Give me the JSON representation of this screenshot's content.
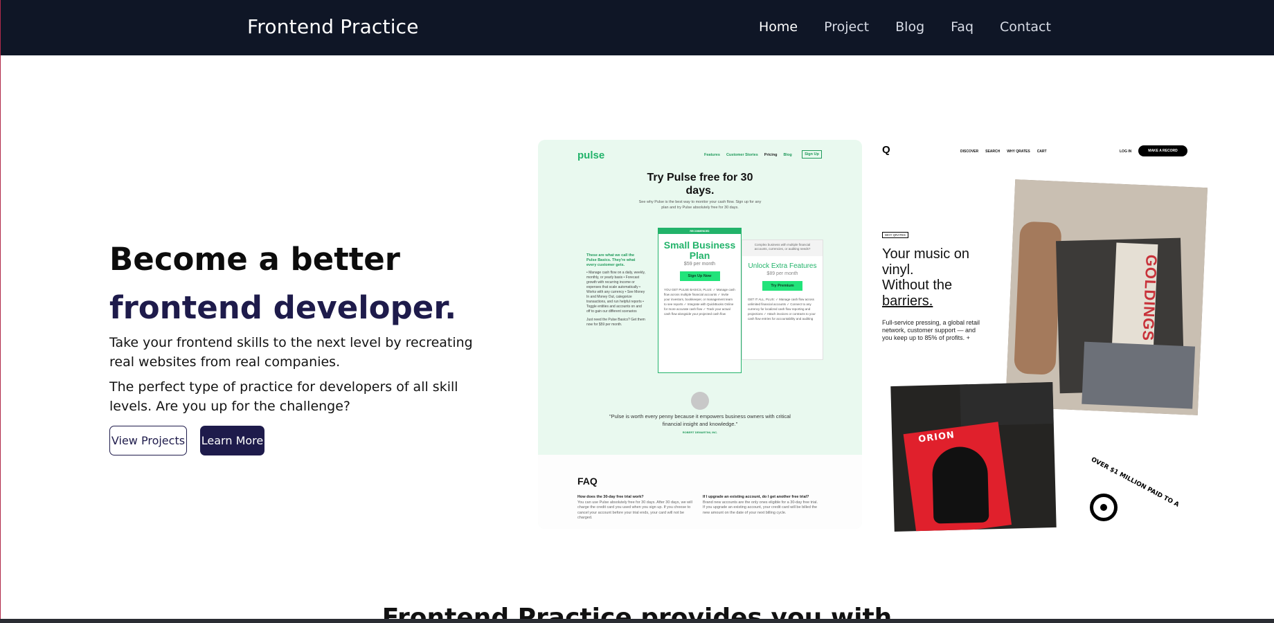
{
  "nav": {
    "brand": "Frontend Practice",
    "links": [
      "Home",
      "Project",
      "Blog",
      "Faq",
      "Contact"
    ]
  },
  "hero": {
    "title_line1": "Become a better",
    "title_line2": "frontend developer.",
    "para1": "Take your frontend skills to the next level by recreating real websites from real companies.",
    "para2": "The perfect type of practice for developers of all skill levels. Are you up for the challenge?",
    "btn_view": "View Projects",
    "btn_learn": "Learn More"
  },
  "pulse": {
    "logo": "pulse",
    "nav": [
      "Features",
      "Customer Stories",
      "Pricing",
      "Blog"
    ],
    "signup": "Sign Up",
    "heading": "Try Pulse free for 30 days.",
    "sub": "See why Pulse is the best way to monitor your cash flow. Sign up for any plan and try Pulse absolutely free for 30 days.",
    "left_title": "These are what we call the Pulse Basics. They're what every customer gets.",
    "left_list": "• Manage cash flow on a daily, weekly, monthly, or yearly basis • Forecast growth with recurring income or expenses that scale automatically • Works with any currency • See Money In and Money Out, categorize transactions, and run helpful reports • Toggle entities and accounts on and off to gain our different scenarios",
    "left_foot": "Just need the Pulse Basics? Get them now for $59 per month.",
    "card1_rec": "RECOMMENDED",
    "card1_title": "Small Business Plan",
    "card1_price": "$59 per month",
    "card1_btn": "Sign Up Now",
    "card1_list": "YOU GET PULSE BASICS, PLUS: ✓ Manage cash flow across multiple financial accounts ✓ Invite your investors, bookkeeper, or management team to see reports ✓ Integrate with QuickBooks Online for more accurate cash flow ✓ Track your actual cash flow alongside your projected cash flow",
    "card2_top": "Complex business with multiple financial accounts, currencies, or auditing needs?",
    "card2_title": "Unlock Extra Features",
    "card2_price": "$89 per month",
    "card2_btn": "Try Premium",
    "card2_list": "GET IT ALL, PLUS: ✓ Manage cash flow across unlimited financial accounts ✓ Connect to any currency for localized cash flow reporting and projections ✓ Attach invoices or contracts to your cash flow entries for accountability and auditing",
    "quote": "\"Pulse is worth every penny because it empowers business owners with critical financial insight and knowledge.\"",
    "author": "ROBERT DEMARTINI, INC.",
    "faq_title": "FAQ",
    "faq_q1": "How does the 30-day free trial work?",
    "faq_a1": "You can use Pulse absolutely free for 30 days. After 30 days, we will charge the credit card you used when you sign up. If you choose to cancel your account before your trial ends, your card will not be charged.",
    "faq_q2": "If I upgrade an existing account, do I get another free trial?",
    "faq_a2": "Brand new accounts are the only ones eligible for a 30-day free trial. If you upgrade an existing account, your credit card will be billed the new amount on the date of your next billing cycle."
  },
  "qrates": {
    "logo": "Q",
    "nav": [
      "DISCOVER",
      "SEARCH",
      "WHY QRATES",
      "CART"
    ],
    "login": "LOG IN",
    "cta": "MAKE A RECORD",
    "tag": "WHY QRATES",
    "h1": "Your music on vinyl.",
    "h2": "Without the",
    "h3": "barriers.",
    "para": "Full-service pressing, a global retail network, customer support — and you keep up to 85% of profits. +",
    "record1": "GOLDINGS",
    "record2": "ORION",
    "badge": "OVER $1 MILLION PAID TO A"
  },
  "section": {
    "title": "Frontend Practice provides you with"
  }
}
